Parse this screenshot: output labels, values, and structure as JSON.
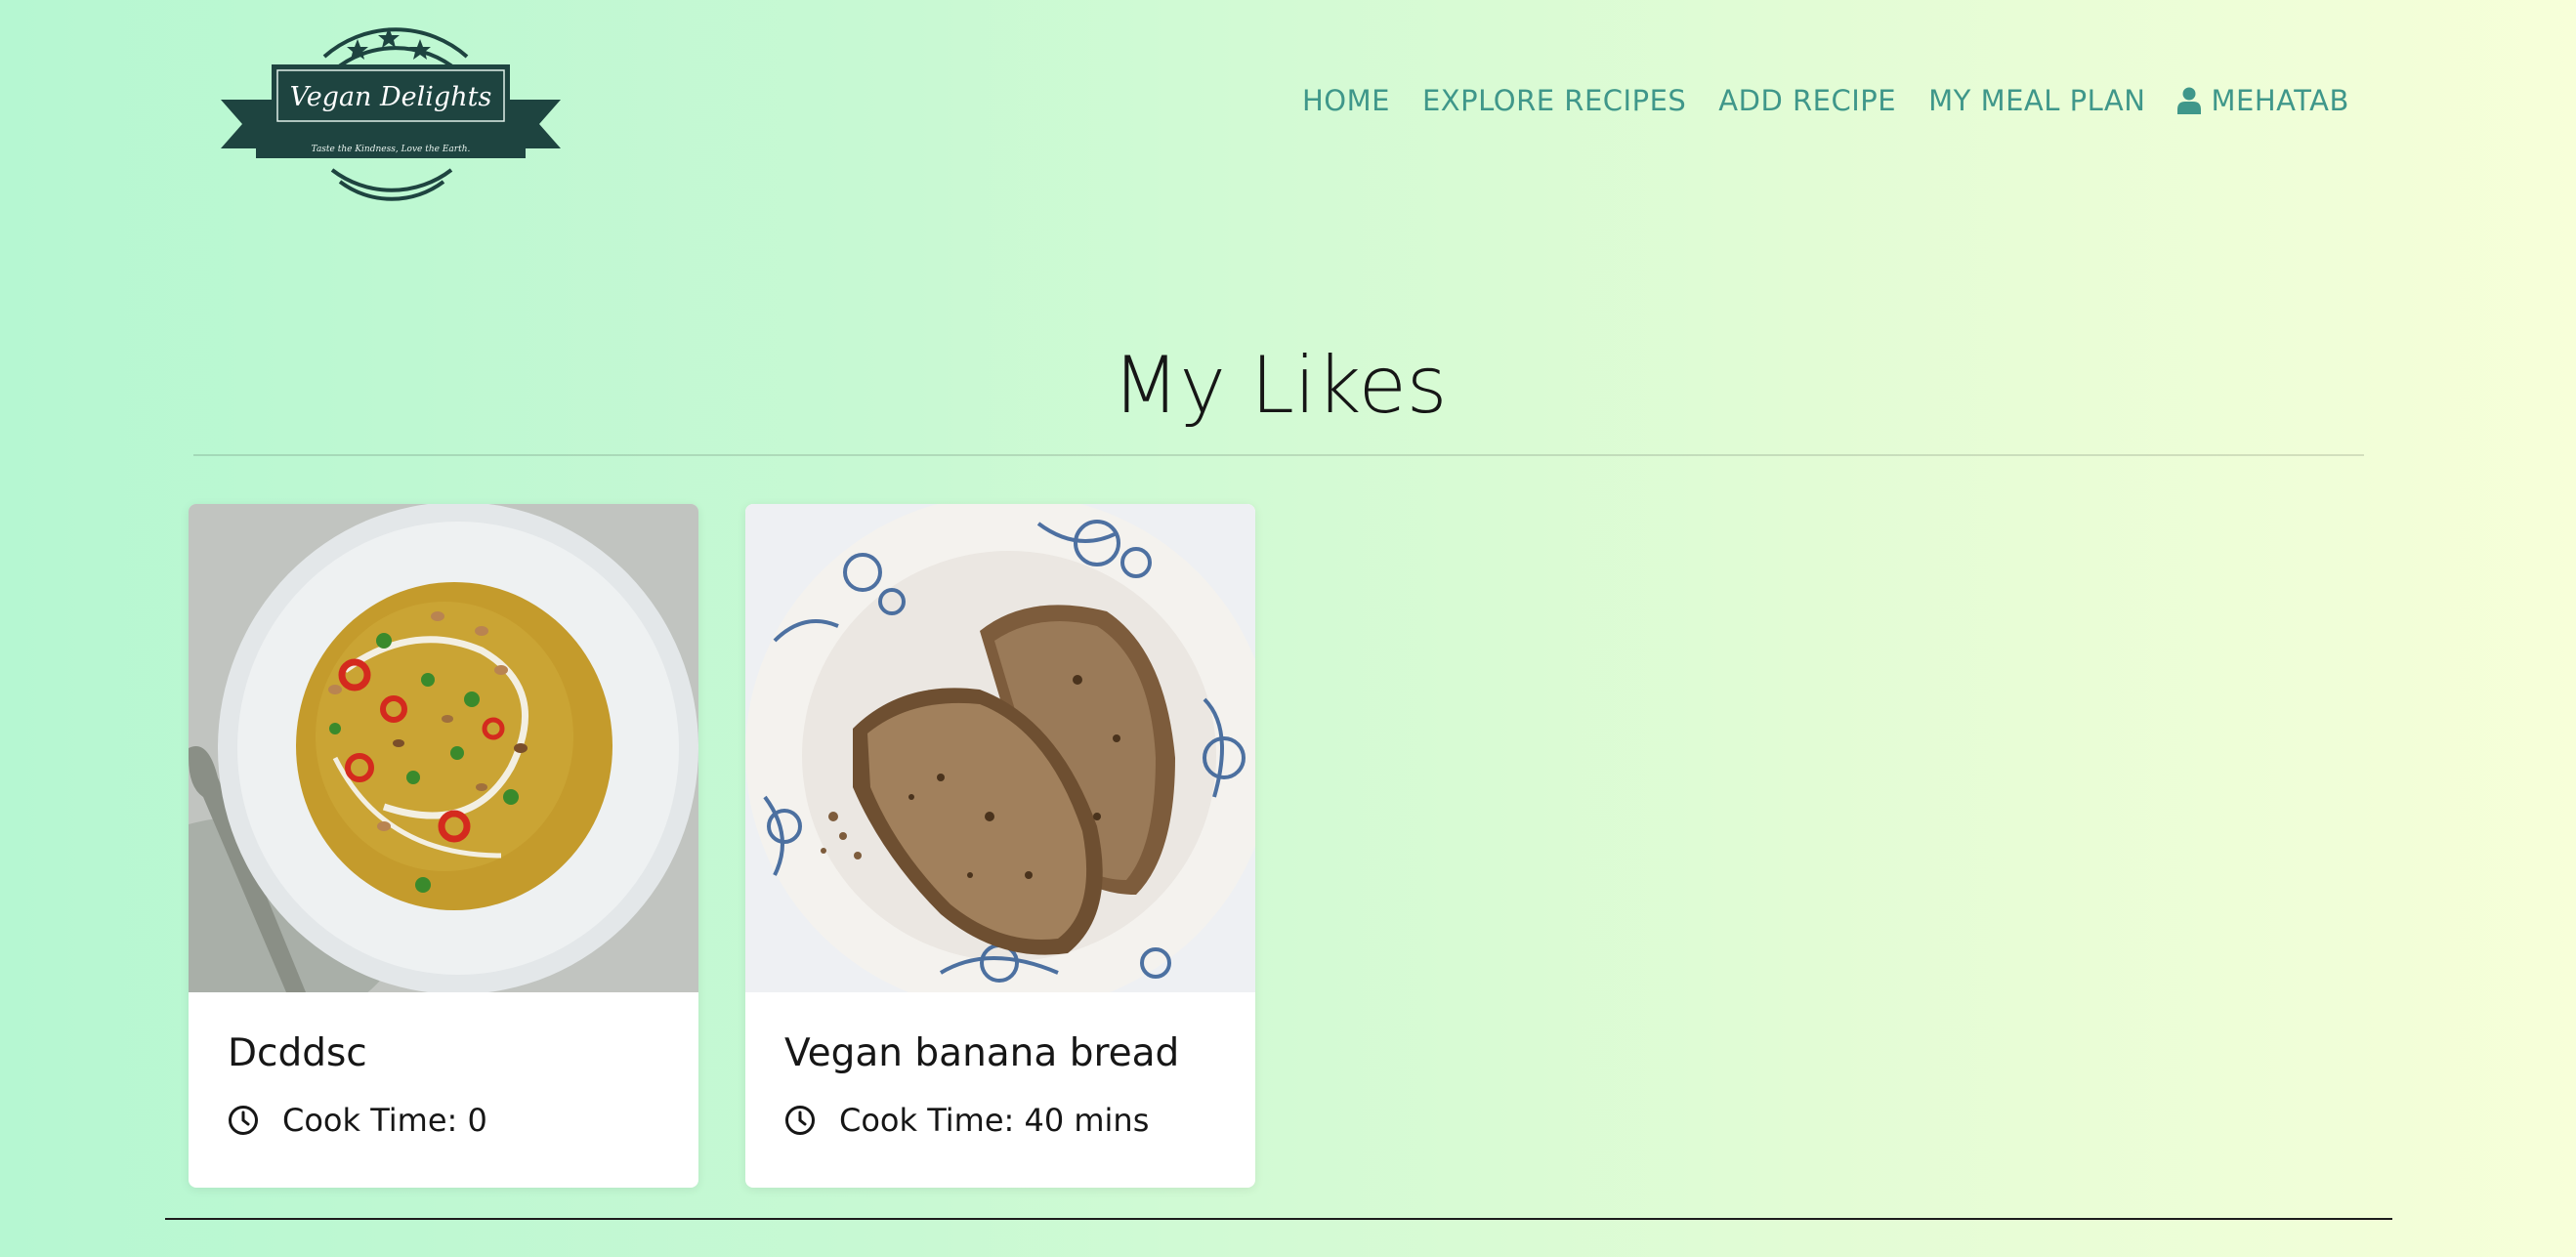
{
  "brand": {
    "name": "Vegan Delights",
    "tagline": "Taste the Kindness, Love the Earth.",
    "colors": {
      "logo": "#1e4440",
      "nav": "#3f978a"
    }
  },
  "nav": {
    "items": [
      {
        "label": "HOME"
      },
      {
        "label": "EXPLORE RECIPES"
      },
      {
        "label": "ADD RECIPE"
      },
      {
        "label": "MY MEAL PLAN"
      },
      {
        "label": "MEHATAB",
        "icon": "user-icon"
      }
    ]
  },
  "page": {
    "title": "My Likes"
  },
  "cards": [
    {
      "title": "Dcddsc",
      "cook_time": "Cook Time: 0",
      "icon": "clock-icon",
      "image": "soup-bowl"
    },
    {
      "title": "Vegan banana bread",
      "cook_time": "Cook Time: 40 mins",
      "icon": "clock-icon",
      "image": "banana-bread-plate"
    }
  ]
}
